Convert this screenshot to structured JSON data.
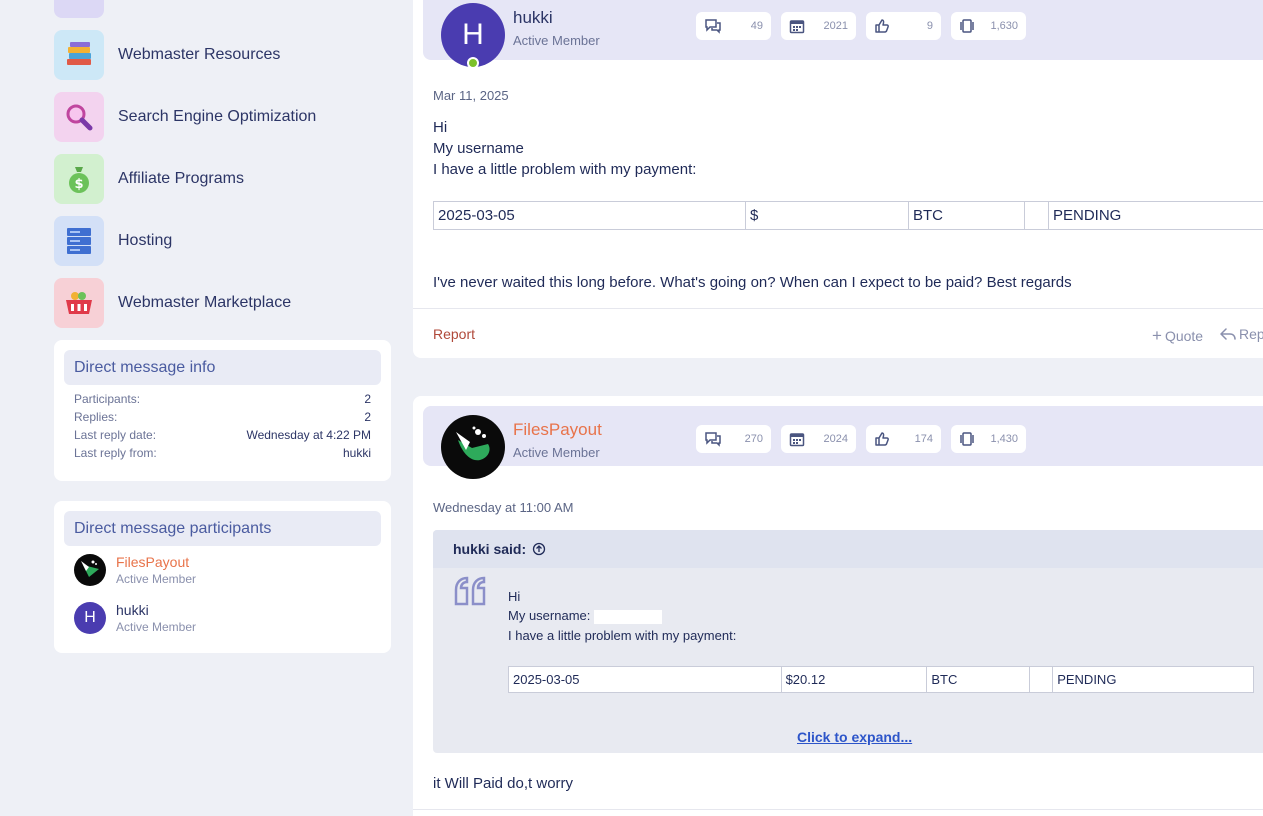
{
  "sidebar": {
    "categories": [
      {
        "label": "Webmaster Resources",
        "icon": "books-icon"
      },
      {
        "label": "Search Engine Optimization",
        "icon": "magnifier-icon"
      },
      {
        "label": "Affiliate Programs",
        "icon": "money-bag-icon"
      },
      {
        "label": "Hosting",
        "icon": "server-icon"
      },
      {
        "label": "Webmaster Marketplace",
        "icon": "basket-icon"
      }
    ],
    "info": {
      "title": "Direct message info",
      "rows": [
        {
          "label": "Participants:",
          "value": "2"
        },
        {
          "label": "Replies:",
          "value": "2"
        },
        {
          "label": "Last reply date:",
          "value": "Wednesday at 4:22 PM"
        },
        {
          "label": "Last reply from:",
          "value": "hukki"
        }
      ]
    },
    "participants": {
      "title": "Direct message participants",
      "list": [
        {
          "name": "FilesPayout",
          "role": "Active Member"
        },
        {
          "name": "hukki",
          "initial": "H",
          "role": "Active Member"
        }
      ]
    }
  },
  "posts": [
    {
      "author": "hukki",
      "initial": "H",
      "role": "Active Member",
      "stats": {
        "messages": "49",
        "joined": "2021",
        "reactions": "9",
        "points": "1,630"
      },
      "date": "Mar 11, 2025",
      "lines": [
        "Hi",
        "My username",
        "I have a little problem with my payment:"
      ],
      "payment": [
        "2025-03-05",
        "$",
        "BTC",
        "",
        "PENDING"
      ],
      "closing": "I've never waited this long before. What's going on? When can I expect to be paid? Best regards",
      "report": "Report",
      "quote": "Quote",
      "reply": "Rep"
    },
    {
      "author": "FilesPayout",
      "role": "Active Member",
      "stats": {
        "messages": "270",
        "joined": "2024",
        "reactions": "174",
        "points": "1,430"
      },
      "date": "Wednesday at 11:00 AM",
      "quote_author": "hukki said:",
      "quote_lines": [
        "Hi",
        "My username:",
        "I have a little problem with my payment:"
      ],
      "quote_payment": [
        "2025-03-05",
        "$20.12",
        "BTC",
        "",
        "PENDING"
      ],
      "expand": "Click to expand...",
      "reply_text": "it Will Paid do,t worry"
    }
  ],
  "colors": {
    "accent": "#4a3cb0",
    "author_orange": "#e8734a",
    "online": "#7cc12a",
    "report": "#b0493a"
  }
}
